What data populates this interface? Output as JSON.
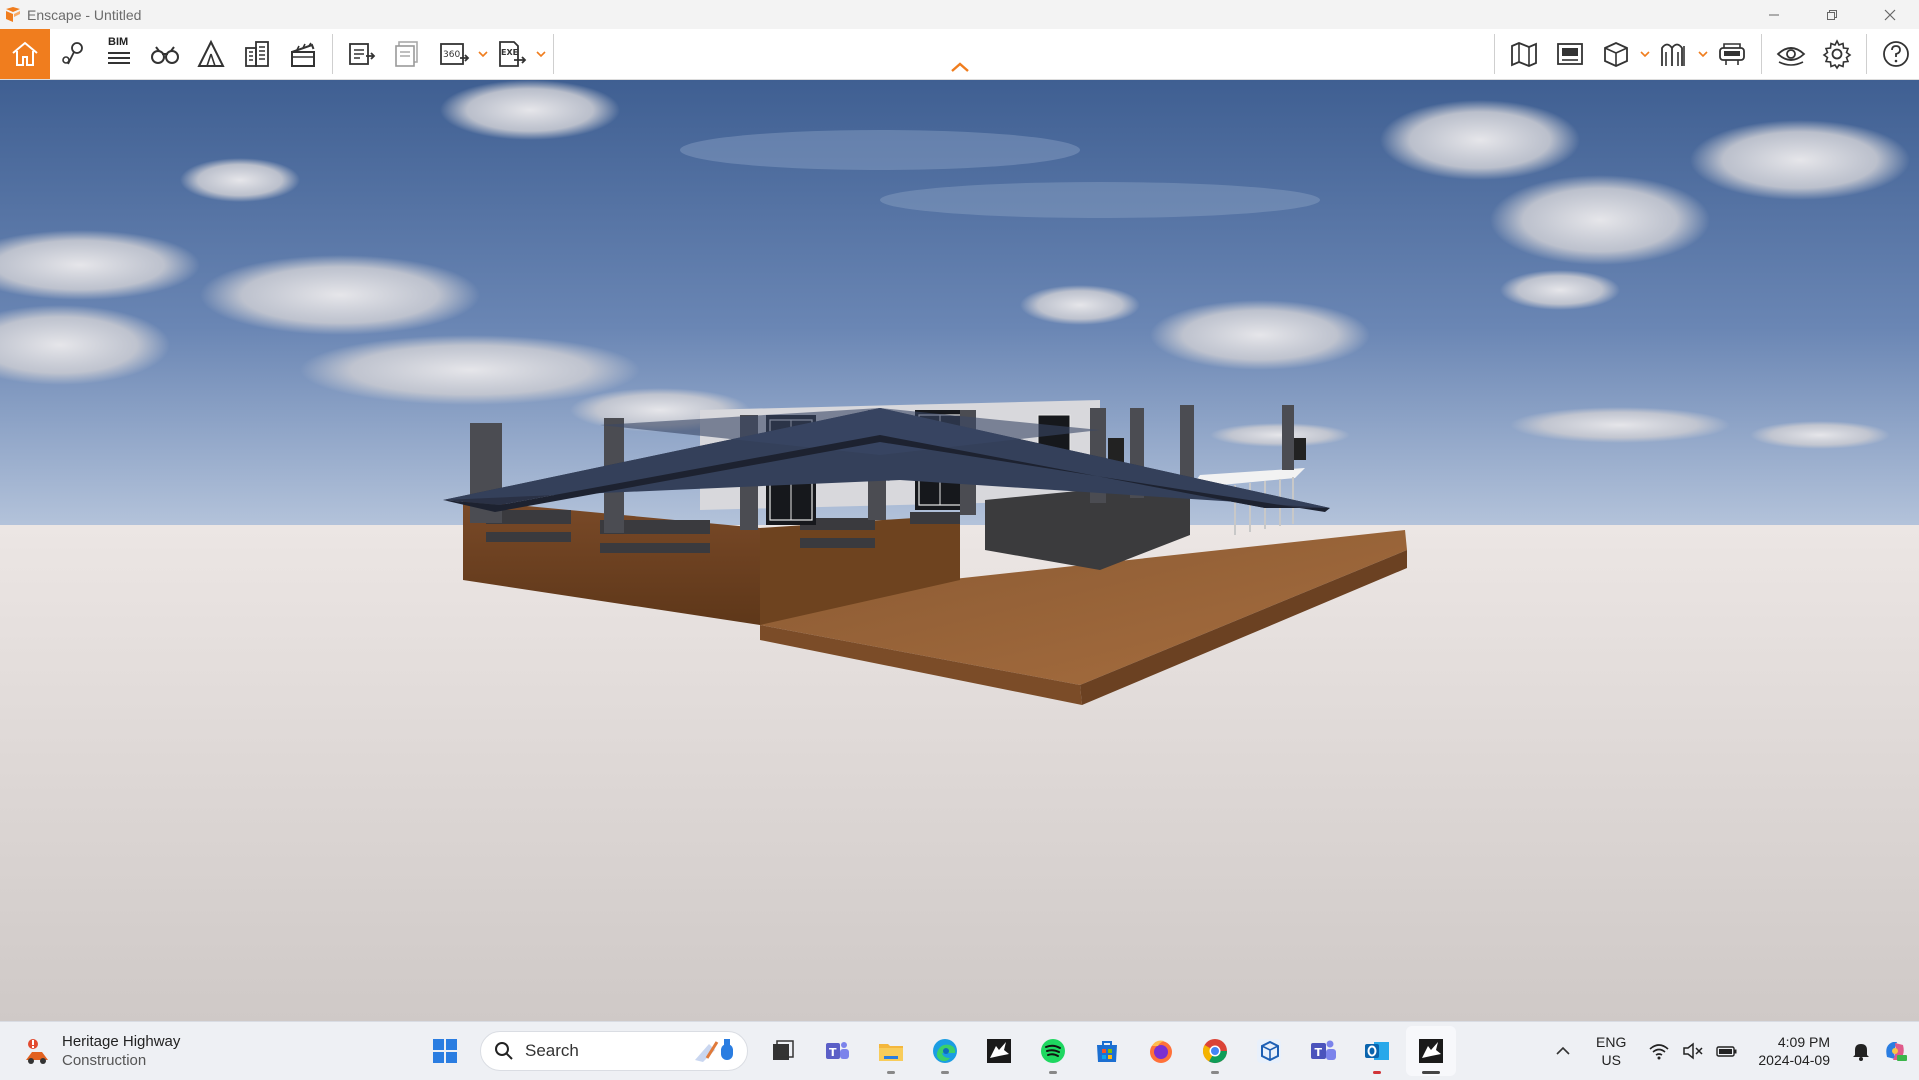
{
  "window": {
    "title": "Enscape - Untitled"
  },
  "toolbar": {
    "bim_label": "BIM",
    "exe_label": "EXE",
    "pano_label": "360"
  },
  "taskbar": {
    "weather": {
      "line1": "Heritage Highway",
      "line2": "Construction"
    },
    "search_label": "Search",
    "lang": {
      "line1": "ENG",
      "line2": "US"
    },
    "clock": {
      "time": "4:09 PM",
      "date": "2024-04-09"
    }
  },
  "colors": {
    "accent": "#f07d1e",
    "sky_top": "#3f5f92",
    "ground": "#dcd6d3"
  }
}
